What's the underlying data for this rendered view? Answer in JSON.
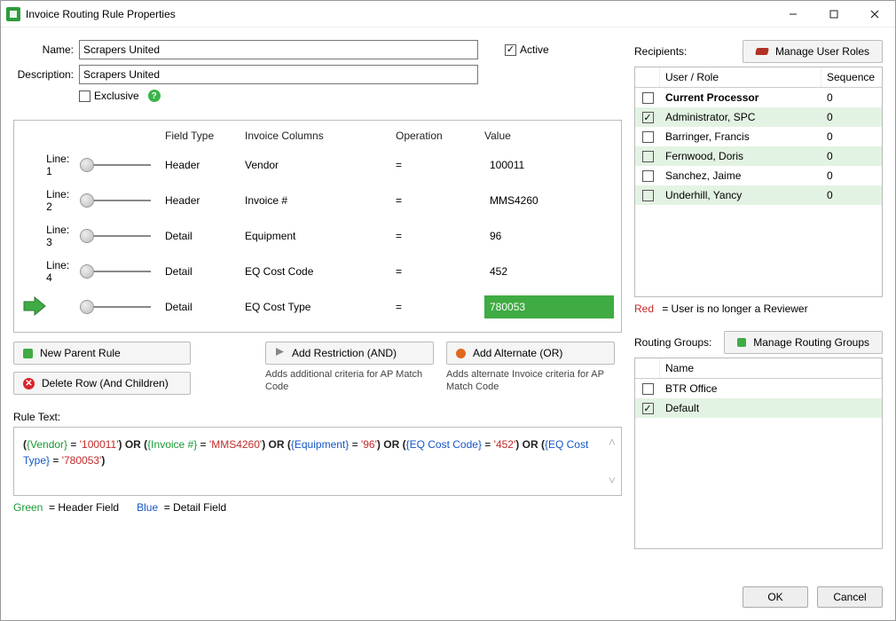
{
  "window": {
    "title": "Invoice Routing Rule Properties"
  },
  "form": {
    "name_label": "Name:",
    "name_value": "Scrapers United",
    "desc_label": "Description:",
    "desc_value": "Scrapers United",
    "exclusive_label": "Exclusive",
    "active_label": "Active"
  },
  "grid": {
    "headers": {
      "field_type": "Field Type",
      "invoice_columns": "Invoice Columns",
      "operation": "Operation",
      "value": "Value"
    },
    "rows": [
      {
        "line": "Line: 1",
        "ftype": "Header",
        "icol": "Vendor",
        "op": "=",
        "val": "100011",
        "active": false
      },
      {
        "line": "Line: 2",
        "ftype": "Header",
        "icol": "Invoice #",
        "op": "=",
        "val": "MMS4260",
        "active": false
      },
      {
        "line": "Line: 3",
        "ftype": "Detail",
        "icol": "Equipment",
        "op": "=",
        "val": "96",
        "active": false
      },
      {
        "line": "Line: 4",
        "ftype": "Detail",
        "icol": "EQ Cost Code",
        "op": "=",
        "val": "452",
        "active": false
      },
      {
        "line": "",
        "ftype": "Detail",
        "icol": "EQ Cost Type",
        "op": "=",
        "val": "780053",
        "active": true
      }
    ]
  },
  "buttons": {
    "new_parent": "New Parent Rule",
    "delete_row": "Delete Row (And Children)",
    "add_and": "Add Restriction (AND)",
    "add_and_desc": "Adds additional criteria for AP Match Code",
    "add_or": "Add Alternate (OR)",
    "add_or_desc": "Adds alternate Invoice criteria for AP Match Code"
  },
  "ruletext": {
    "label": "Rule Text:",
    "legend_green": "Green",
    "legend_green_eq": "= Header Field",
    "legend_blue": "Blue",
    "legend_blue_eq": "= Detail Field"
  },
  "recipients": {
    "label": "Recipients:",
    "manage": "Manage User Roles",
    "cols": {
      "name": "User / Role",
      "seq": "Sequence"
    },
    "rows": [
      {
        "name": "Current Processor",
        "seq": "0",
        "checked": false,
        "bold": true
      },
      {
        "name": "Administrator, SPC",
        "seq": "0",
        "checked": true
      },
      {
        "name": "Barringer, Francis",
        "seq": "0",
        "checked": false
      },
      {
        "name": "Fernwood, Doris",
        "seq": "0",
        "checked": false
      },
      {
        "name": "Sanchez, Jaime",
        "seq": "0",
        "checked": false
      },
      {
        "name": "Underhill, Yancy",
        "seq": "0",
        "checked": false
      }
    ],
    "note_red": "Red",
    "note_rest": "= User is no longer a Reviewer"
  },
  "routing": {
    "label": "Routing Groups:",
    "manage": "Manage Routing Groups",
    "cols": {
      "name": "Name"
    },
    "rows": [
      {
        "name": "BTR Office",
        "checked": false
      },
      {
        "name": "Default",
        "checked": true
      }
    ]
  },
  "footer": {
    "ok": "OK",
    "cancel": "Cancel"
  }
}
